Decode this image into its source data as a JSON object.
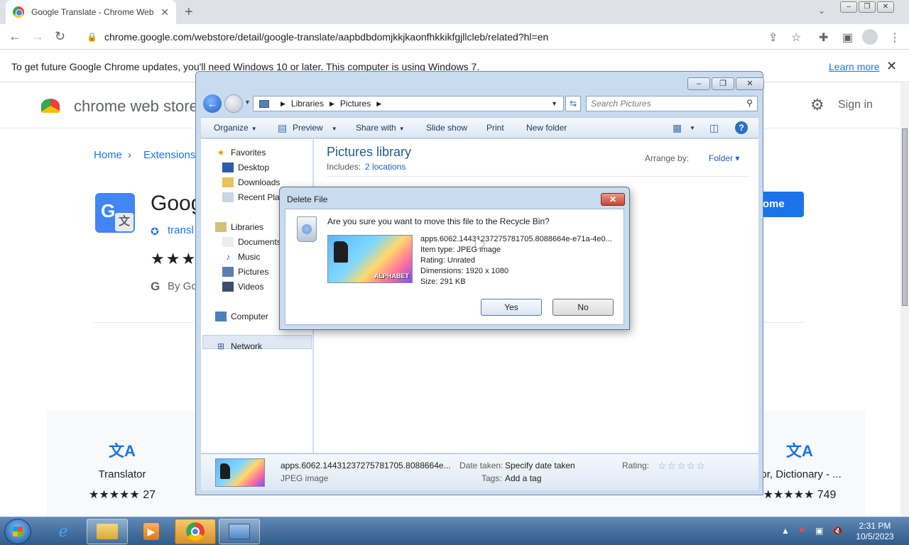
{
  "browser": {
    "tab_title": "Google Translate - Chrome Web",
    "url": "chrome.google.com/webstore/detail/google-translate/aapbdbdomjkkjkaonfhkkikfgjllcleb/related?hl=en",
    "infobar_message": "To get future Google Chrome updates, you'll need Windows 10 or later. This computer is using Windows 7.",
    "infobar_link": "Learn more"
  },
  "webstore": {
    "logo_text": "chrome web store",
    "sign_in": "Sign in",
    "crumb_home": "Home",
    "crumb_extensions": "Extensions",
    "ext_name": "Goog",
    "ext_link": "transl",
    "ext_by": "By Go",
    "add_button": "rome",
    "related": [
      {
        "name": "Translator",
        "stars": "★★★★★",
        "count": "27"
      },
      {
        "name": "tor, Dictionary - ...",
        "stars": "★★★★★",
        "count": "749"
      }
    ]
  },
  "explorer": {
    "breadcrumb": [
      "Libraries",
      "Pictures"
    ],
    "search_placeholder": "Search Pictures",
    "commands": {
      "organize": "Organize",
      "preview": "Preview",
      "share_with": "Share with",
      "slide_show": "Slide show",
      "print": "Print",
      "new_folder": "New folder"
    },
    "nav": {
      "favorites": "Favorites",
      "desktop": "Desktop",
      "downloads": "Downloads",
      "recent_places": "Recent Plac",
      "libraries": "Libraries",
      "documents": "Documents",
      "music": "Music",
      "pictures": "Pictures",
      "videos": "Videos",
      "computer": "Computer",
      "network": "Network"
    },
    "library_title": "Pictures library",
    "includes_label": "Includes:",
    "includes_link": "2 locations",
    "arrange_label": "Arrange by:",
    "arrange_value": "Folder",
    "details": {
      "file_name": "apps.6062.14431237275781705.8088664e...",
      "file_type": "JPEG image",
      "date_taken_label": "Date taken:",
      "date_taken_value": "Specify date taken",
      "tags_label": "Tags:",
      "tags_value": "Add a tag",
      "rating_label": "Rating:",
      "rating_stars": "☆☆☆☆☆"
    }
  },
  "dialog": {
    "title": "Delete File",
    "question": "Are you sure you want to move this file to the Recycle Bin?",
    "file_name": "apps.6062.14431237275781705.8088664e-e71a-4e0...",
    "item_type": "Item type: JPEG image",
    "rating": "Rating: Unrated",
    "dimensions": "Dimensions: 1920 x 1080",
    "size": "Size: 291 KB",
    "yes": "Yes",
    "no": "No",
    "thumb_text": "ALPHABET"
  },
  "taskbar": {
    "time": "2:31 PM",
    "date": "10/5/2023"
  },
  "icons": {
    "start": "windows-start-icon",
    "ie": "internet-explorer-icon",
    "explorer": "folder-icon",
    "media": "media-player-icon",
    "chrome": "chrome-icon",
    "control": "control-panel-icon"
  }
}
